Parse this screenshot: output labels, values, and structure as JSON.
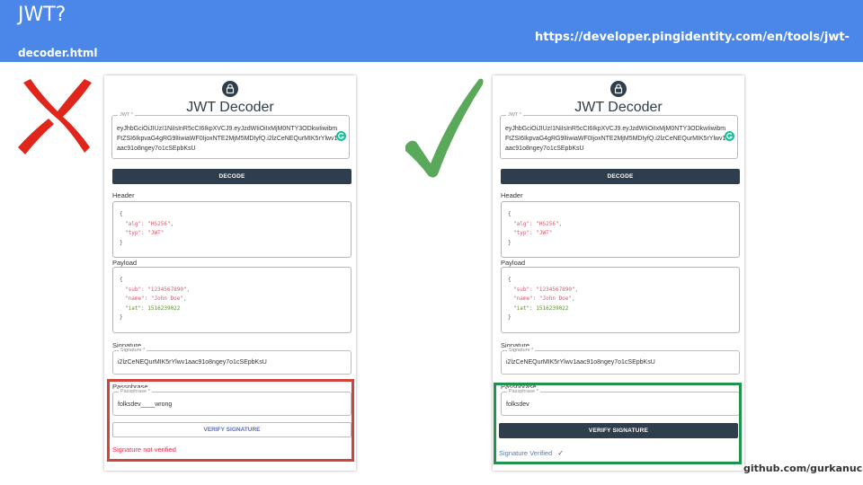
{
  "banner": {
    "title": "JWT?",
    "subtitle": "decoder.html",
    "url": "https://developer.pingidentity.com/en/tools/jwt-",
    "color": "#4b87e8"
  },
  "left_panel": {
    "title": "JWT Decoder",
    "jwt_legend": "JWT *",
    "jwt_value": "eyJhbGciOiJIUzI1NiIsInR5cCI6IkpXVCJ9.eyJzdWIiOiIxMjM0NTY3ODkwIiwibmFtZSI6IkpvaG4gRG9lIiwiaWF0IjoxNTE2MjM5MDIyfQ.i2lzCeNEQurMIK5rYlwv1aac91o8ngey7o1cSEpbKsU",
    "decode_label": "DECODE",
    "header_label": "Header",
    "header_lines": [
      "{",
      "\"alg\": \"HS256\",",
      "\"typ\": \"JWT\"",
      "}"
    ],
    "payload_label": "Payload",
    "payload_lines": [
      "{",
      "\"sub\": \"1234567890\",",
      "\"name\": \"John Doe\",",
      "\"iat\": 1516239022",
      "}"
    ],
    "signature_label": "Signature",
    "signature_legend": "Signature *",
    "signature_value": "i2lzCeNEQurMIK5rYlwv1aac91o8ngey7o1cSEpbKsU",
    "passphrase_label": "Passphrase",
    "passphrase_legend": "Passphrase *",
    "passphrase_value": "folksdev____wrong",
    "verify_label": "VERIFY SIGNATURE",
    "status": "Signature not verified",
    "status_color": "#e5304d"
  },
  "right_panel": {
    "title": "JWT Decoder",
    "jwt_legend": "JWT *",
    "jwt_value": "eyJhbGciOiJIUzI1NiIsInR5cCI6IkpXVCJ9.eyJzdWIiOiIxMjM0NTY3ODkwIiwibmFtZSI6IkpvaG4gRG9lIiwiaWF0IjoxNTE2MjM5MDIyfQ.i2lzCeNEQurMIK5rYlwv1aac91o8ngey7o1cSEpbKsU",
    "decode_label": "DECODE",
    "header_label": "Header",
    "header_lines": [
      "{",
      "\"alg\": \"HS256\",",
      "\"typ\": \"JWT\"",
      "}"
    ],
    "payload_label": "Payload",
    "payload_lines": [
      "{",
      "\"sub\": \"1234567890\",",
      "\"name\": \"John Doe\",",
      "\"iat\": 1516239022",
      "}"
    ],
    "signature_label": "Signature",
    "signature_legend": "Signature *",
    "signature_value": "i2lzCeNEQurMIK5rYlwv1aac91o8ngey7o1cSEpbKsU",
    "passphrase_label": "Passphrase",
    "passphrase_legend": "Passphrase *",
    "passphrase_value": "folksdev",
    "verify_label": "VERIFY SIGNATURE",
    "status": "Signature Verified",
    "status_color": "#5c7aa8"
  },
  "marks": {
    "wrong_icon": "red-x-icon",
    "wrong_color": "#e0251b",
    "right_icon": "green-check-icon",
    "right_color": "#5aa85a"
  },
  "highlights": {
    "fail_color": "#d0453a",
    "ok_color": "#22934c"
  },
  "credit": "github.com/gurkanucar"
}
